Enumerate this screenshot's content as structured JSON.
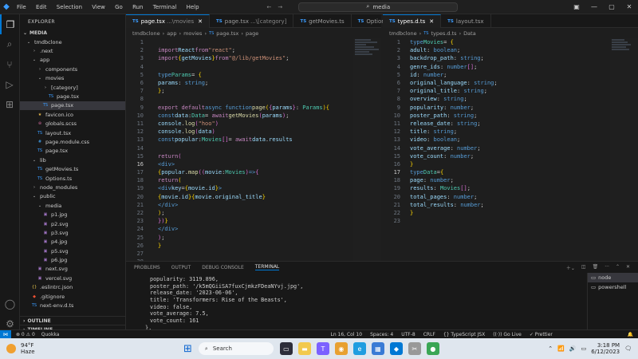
{
  "titlebar": {
    "menu": [
      "File",
      "Edit",
      "Selection",
      "View",
      "Go",
      "Run",
      "Terminal",
      "Help"
    ],
    "search": "media"
  },
  "explorer": {
    "title": "EXPLORER",
    "root": "MEDIA",
    "items": [
      {
        "label": "tmdbclone",
        "depth": 0,
        "kind": "folder-open"
      },
      {
        "label": ".next",
        "depth": 1,
        "kind": "folder"
      },
      {
        "label": "app",
        "depth": 1,
        "kind": "folder-open"
      },
      {
        "label": "components",
        "depth": 2,
        "kind": "folder"
      },
      {
        "label": "movies",
        "depth": 2,
        "kind": "folder-open"
      },
      {
        "label": "[category]",
        "depth": 3,
        "kind": "folder"
      },
      {
        "label": "page.tsx",
        "depth": 4,
        "kind": "ts"
      },
      {
        "label": "page.tsx",
        "depth": 3,
        "kind": "ts",
        "selected": true
      },
      {
        "label": "favicon.ico",
        "depth": 2,
        "kind": "ico"
      },
      {
        "label": "globals.scss",
        "depth": 2,
        "kind": "scss"
      },
      {
        "label": "layout.tsx",
        "depth": 2,
        "kind": "ts"
      },
      {
        "label": "page.module.css",
        "depth": 2,
        "kind": "css"
      },
      {
        "label": "page.tsx",
        "depth": 2,
        "kind": "ts"
      },
      {
        "label": "lib",
        "depth": 1,
        "kind": "folder-open"
      },
      {
        "label": "getMovies.ts",
        "depth": 2,
        "kind": "ts"
      },
      {
        "label": "Options.ts",
        "depth": 2,
        "kind": "ts"
      },
      {
        "label": "node_modules",
        "depth": 1,
        "kind": "folder"
      },
      {
        "label": "public",
        "depth": 1,
        "kind": "folder-open"
      },
      {
        "label": "media",
        "depth": 2,
        "kind": "folder-open"
      },
      {
        "label": "p1.jpg",
        "depth": 3,
        "kind": "img"
      },
      {
        "label": "p2.svg",
        "depth": 3,
        "kind": "img"
      },
      {
        "label": "p3.svg",
        "depth": 3,
        "kind": "img"
      },
      {
        "label": "p4.jpg",
        "depth": 3,
        "kind": "img"
      },
      {
        "label": "p5.svg",
        "depth": 3,
        "kind": "img"
      },
      {
        "label": "p6.jpg",
        "depth": 3,
        "kind": "img"
      },
      {
        "label": "next.svg",
        "depth": 2,
        "kind": "img"
      },
      {
        "label": "vercel.svg",
        "depth": 2,
        "kind": "img"
      },
      {
        "label": ".eslintrc.json",
        "depth": 1,
        "kind": "json"
      },
      {
        "label": ".gitignore",
        "depth": 1,
        "kind": "git"
      },
      {
        "label": "next-env.d.ts",
        "depth": 1,
        "kind": "ts"
      }
    ],
    "outline": "OUTLINE",
    "timeline": "TIMELINE"
  },
  "left_editor": {
    "tabs": [
      {
        "label": "page.tsx",
        "dim": "...\\movies",
        "active": true
      },
      {
        "label": "page.tsx",
        "dim": "...\\[category]",
        "active": false
      },
      {
        "label": "getMovies.ts",
        "dim": "",
        "active": false
      },
      {
        "label": "Options",
        "dim": "",
        "active": false
      }
    ],
    "breadcrumb": [
      "tmdbclone",
      "app",
      "movies",
      "page.tsx",
      "page"
    ]
  },
  "right_editor": {
    "tabs": [
      {
        "label": "types.d.ts",
        "dim": "",
        "active": true
      },
      {
        "label": "layout.tsx",
        "dim": "",
        "active": false
      }
    ],
    "breadcrumb": [
      "tmdbclone",
      "types.d.ts",
      "Data"
    ]
  },
  "panel": {
    "tabs": [
      "PROBLEMS",
      "OUTPUT",
      "DEBUG CONSOLE",
      "TERMINAL"
    ],
    "terminal_lines": [
      "popularity: 3119.896,",
      "poster_path: '/k5mQGiiSA7fuxCjmkzFDeaNYvj.jpg',",
      "release_date: '2023-06-06',",
      "title: 'Transformers: Rise of the Beasts',",
      "video: false,",
      "vote_average: 7.5,",
      "vote_count: 161",
      "},"
    ],
    "terminals": [
      "node",
      "powershell"
    ]
  },
  "statusbar": {
    "problems": "⊗ 0 ⚠ 0",
    "quokka": "Quokka",
    "position": "Ln 16, Col 10",
    "spaces": "Spaces: 4",
    "encoding": "UTF-8",
    "eol": "CRLF",
    "language": "{} TypeScript JSX",
    "golive": "Go Live",
    "prettier": "✓ Prettier"
  },
  "taskbar": {
    "temp": "94°F",
    "weather": "Haze",
    "search": "Search",
    "time": "3:18 PM",
    "date": "6/12/2023"
  },
  "colors": {
    "accent": "#0078d4",
    "keyword": "#569cd6",
    "string": "#ce9178",
    "type": "#4ec9b0"
  }
}
